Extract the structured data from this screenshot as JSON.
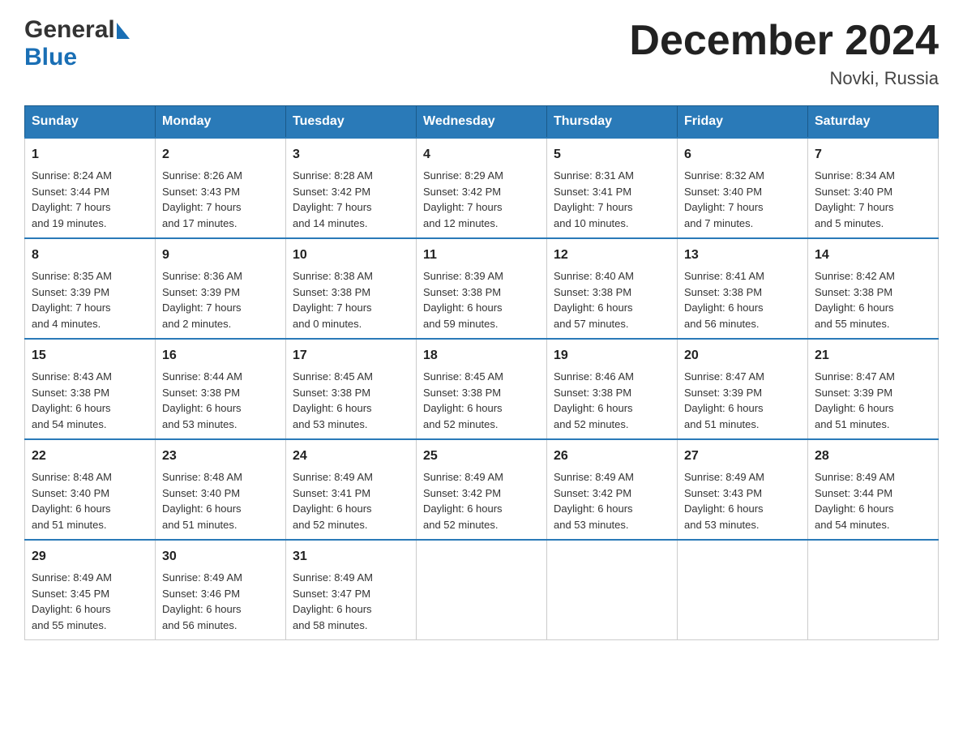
{
  "header": {
    "logo_general": "General",
    "logo_blue": "Blue",
    "title": "December 2024",
    "location": "Novki, Russia"
  },
  "days_of_week": [
    "Sunday",
    "Monday",
    "Tuesday",
    "Wednesday",
    "Thursday",
    "Friday",
    "Saturday"
  ],
  "weeks": [
    [
      {
        "day": "1",
        "sunrise": "8:24 AM",
        "sunset": "3:44 PM",
        "daylight": "7 hours and 19 minutes."
      },
      {
        "day": "2",
        "sunrise": "8:26 AM",
        "sunset": "3:43 PM",
        "daylight": "7 hours and 17 minutes."
      },
      {
        "day": "3",
        "sunrise": "8:28 AM",
        "sunset": "3:42 PM",
        "daylight": "7 hours and 14 minutes."
      },
      {
        "day": "4",
        "sunrise": "8:29 AM",
        "sunset": "3:42 PM",
        "daylight": "7 hours and 12 minutes."
      },
      {
        "day": "5",
        "sunrise": "8:31 AM",
        "sunset": "3:41 PM",
        "daylight": "7 hours and 10 minutes."
      },
      {
        "day": "6",
        "sunrise": "8:32 AM",
        "sunset": "3:40 PM",
        "daylight": "7 hours and 7 minutes."
      },
      {
        "day": "7",
        "sunrise": "8:34 AM",
        "sunset": "3:40 PM",
        "daylight": "7 hours and 5 minutes."
      }
    ],
    [
      {
        "day": "8",
        "sunrise": "8:35 AM",
        "sunset": "3:39 PM",
        "daylight": "7 hours and 4 minutes."
      },
      {
        "day": "9",
        "sunrise": "8:36 AM",
        "sunset": "3:39 PM",
        "daylight": "7 hours and 2 minutes."
      },
      {
        "day": "10",
        "sunrise": "8:38 AM",
        "sunset": "3:38 PM",
        "daylight": "7 hours and 0 minutes."
      },
      {
        "day": "11",
        "sunrise": "8:39 AM",
        "sunset": "3:38 PM",
        "daylight": "6 hours and 59 minutes."
      },
      {
        "day": "12",
        "sunrise": "8:40 AM",
        "sunset": "3:38 PM",
        "daylight": "6 hours and 57 minutes."
      },
      {
        "day": "13",
        "sunrise": "8:41 AM",
        "sunset": "3:38 PM",
        "daylight": "6 hours and 56 minutes."
      },
      {
        "day": "14",
        "sunrise": "8:42 AM",
        "sunset": "3:38 PM",
        "daylight": "6 hours and 55 minutes."
      }
    ],
    [
      {
        "day": "15",
        "sunrise": "8:43 AM",
        "sunset": "3:38 PM",
        "daylight": "6 hours and 54 minutes."
      },
      {
        "day": "16",
        "sunrise": "8:44 AM",
        "sunset": "3:38 PM",
        "daylight": "6 hours and 53 minutes."
      },
      {
        "day": "17",
        "sunrise": "8:45 AM",
        "sunset": "3:38 PM",
        "daylight": "6 hours and 53 minutes."
      },
      {
        "day": "18",
        "sunrise": "8:45 AM",
        "sunset": "3:38 PM",
        "daylight": "6 hours and 52 minutes."
      },
      {
        "day": "19",
        "sunrise": "8:46 AM",
        "sunset": "3:38 PM",
        "daylight": "6 hours and 52 minutes."
      },
      {
        "day": "20",
        "sunrise": "8:47 AM",
        "sunset": "3:39 PM",
        "daylight": "6 hours and 51 minutes."
      },
      {
        "day": "21",
        "sunrise": "8:47 AM",
        "sunset": "3:39 PM",
        "daylight": "6 hours and 51 minutes."
      }
    ],
    [
      {
        "day": "22",
        "sunrise": "8:48 AM",
        "sunset": "3:40 PM",
        "daylight": "6 hours and 51 minutes."
      },
      {
        "day": "23",
        "sunrise": "8:48 AM",
        "sunset": "3:40 PM",
        "daylight": "6 hours and 51 minutes."
      },
      {
        "day": "24",
        "sunrise": "8:49 AM",
        "sunset": "3:41 PM",
        "daylight": "6 hours and 52 minutes."
      },
      {
        "day": "25",
        "sunrise": "8:49 AM",
        "sunset": "3:42 PM",
        "daylight": "6 hours and 52 minutes."
      },
      {
        "day": "26",
        "sunrise": "8:49 AM",
        "sunset": "3:42 PM",
        "daylight": "6 hours and 53 minutes."
      },
      {
        "day": "27",
        "sunrise": "8:49 AM",
        "sunset": "3:43 PM",
        "daylight": "6 hours and 53 minutes."
      },
      {
        "day": "28",
        "sunrise": "8:49 AM",
        "sunset": "3:44 PM",
        "daylight": "6 hours and 54 minutes."
      }
    ],
    [
      {
        "day": "29",
        "sunrise": "8:49 AM",
        "sunset": "3:45 PM",
        "daylight": "6 hours and 55 minutes."
      },
      {
        "day": "30",
        "sunrise": "8:49 AM",
        "sunset": "3:46 PM",
        "daylight": "6 hours and 56 minutes."
      },
      {
        "day": "31",
        "sunrise": "8:49 AM",
        "sunset": "3:47 PM",
        "daylight": "6 hours and 58 minutes."
      },
      null,
      null,
      null,
      null
    ]
  ],
  "sunrise_label": "Sunrise:",
  "sunset_label": "Sunset:",
  "daylight_label": "Daylight:"
}
